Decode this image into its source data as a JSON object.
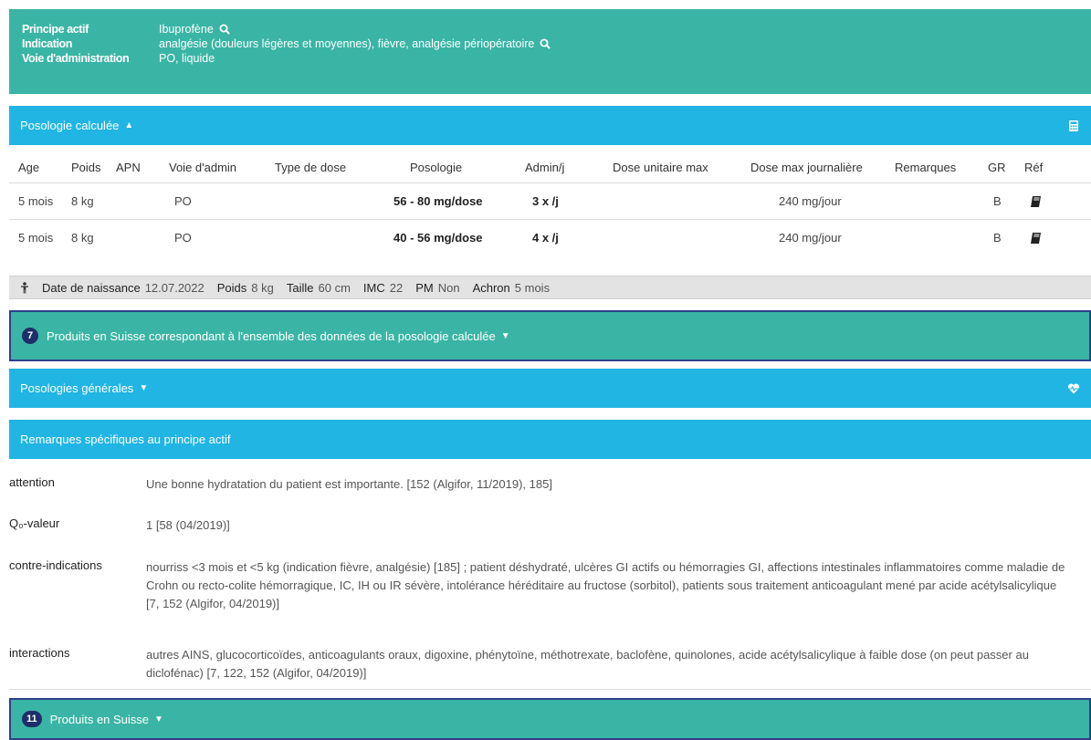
{
  "header": {
    "rows": [
      {
        "label": "Principe actif",
        "value": "Ibuprofène",
        "search": true
      },
      {
        "label": "Indication",
        "value": "analgésie (douleurs légères et moyennes), fièvre, analgésie périopératoire",
        "search": true
      },
      {
        "label": "Voie d'administration",
        "value": "PO, liquide",
        "search": false
      }
    ]
  },
  "posologie_bar": {
    "title": "Posologie calculée",
    "caret": "▲",
    "icon": "calculator-icon"
  },
  "table": {
    "columns": [
      "Age",
      "Poids",
      "APN",
      "Voie d'admin",
      "Type de dose",
      "Posologie",
      "Admin/j",
      "Dose unitaire max",
      "Dose max journalière",
      "Remarques",
      "GR",
      "Réf"
    ],
    "rows": [
      {
        "age": "5 mois",
        "poids": "8 kg",
        "apn": "",
        "voie": "PO",
        "type": "",
        "posologie": "56 - 80 mg/dose",
        "admin": "3 x /j",
        "unitaire": "",
        "journaliere": "240 mg/jour",
        "remarques": "",
        "gr": "B",
        "ref_icon": "book-icon"
      },
      {
        "age": "5 mois",
        "poids": "8 kg",
        "apn": "",
        "voie": "PO",
        "type": "",
        "posologie": "40 - 56 mg/dose",
        "admin": "4 x /j",
        "unitaire": "",
        "journaliere": "240 mg/jour",
        "remarques": "",
        "gr": "B",
        "ref_icon": "book-icon"
      }
    ]
  },
  "patient": {
    "icon": "person-icon",
    "fields": [
      {
        "label": "Date de naissance",
        "value": "12.07.2022"
      },
      {
        "label": "Poids",
        "value": "8 kg"
      },
      {
        "label": "Taille",
        "value": "60 cm"
      },
      {
        "label": "IMC",
        "value": "22"
      },
      {
        "label": "PM",
        "value": "Non"
      },
      {
        "label": "Achron",
        "value": "5 mois"
      }
    ]
  },
  "produits_bar": {
    "count": "7",
    "title": "Produits en Suisse correspondant à l'ensemble des données de la posologie calculée",
    "caret": "▼"
  },
  "generales_bar": {
    "title": "Posologies générales",
    "caret": "▼",
    "icon": "heart-pulse-icon"
  },
  "remarques_bar": {
    "title": "Remarques spécifiques au principe actif"
  },
  "remarks": [
    {
      "label": "attention",
      "text": "Une bonne hydratation du patient est importante. [152 (Algifor, 11/2019), 185]"
    },
    {
      "label": "Q₀-valeur",
      "text": "1 [58 (04/2019)]"
    },
    {
      "label": "contre-indications",
      "text": "nourriss <3 mois et <5 kg (indication fièvre, analgésie) [185] ; patient déshydraté, ulcères GI actifs ou hémorragies GI, affections intestinales inflammatoires comme maladie de Crohn ou recto-colite hémorragique, IC, IH ou IR sévère, intolérance héréditaire au fructose (sorbitol), patients sous traitement anticoagulant mené par acide acétylsalicylique [7, 152 (Algifor, 04/2019)]"
    },
    {
      "label": "interactions",
      "text": "autres AINS, glucocorticoïdes, anticoagulants oraux, digoxine, phénytoïne, méthotrexate, baclofène, quinolones, acide acétylsalicylique à faible dose (on peut passer au diclofénac) [7, 122, 152 (Algifor, 04/2019)]"
    }
  ],
  "suisse_bar": {
    "count": "11",
    "title": "Produits en Suisse",
    "caret": "▼"
  },
  "colors": {
    "teal": "#3ab5a5",
    "blue": "#21b5e3",
    "navy": "#1d2f6a"
  }
}
